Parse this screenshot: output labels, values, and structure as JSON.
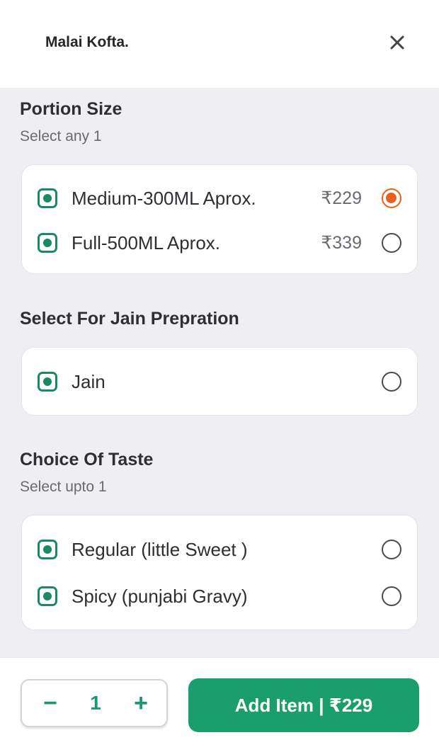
{
  "header": {
    "title": "Malai Kofta.",
    "close_icon": "close-icon"
  },
  "portion": {
    "title": "Portion Size",
    "subtitle": "Select any 1",
    "options": [
      {
        "label": "Medium-300ML Aprox.",
        "price": "₹229",
        "selected": true
      },
      {
        "label": "Full-500ML Aprox.",
        "price": "₹339",
        "selected": false
      }
    ]
  },
  "jain": {
    "title": "Select For Jain Prepration",
    "options": [
      {
        "label": "Jain",
        "selected": false
      }
    ]
  },
  "taste": {
    "title": "Choice Of Taste",
    "subtitle": "Select upto 1",
    "options": [
      {
        "label": "Regular (little Sweet )",
        "selected": false
      },
      {
        "label": "Spicy (punjabi Gravy)",
        "selected": false
      }
    ]
  },
  "footer": {
    "quantity": "1",
    "minus": "−",
    "plus": "+",
    "add_label": "Add Item | ₹229"
  },
  "colors": {
    "accent": "#1b9e6d",
    "radio_selected": "#e9601d",
    "veg": "#1a8a63"
  }
}
